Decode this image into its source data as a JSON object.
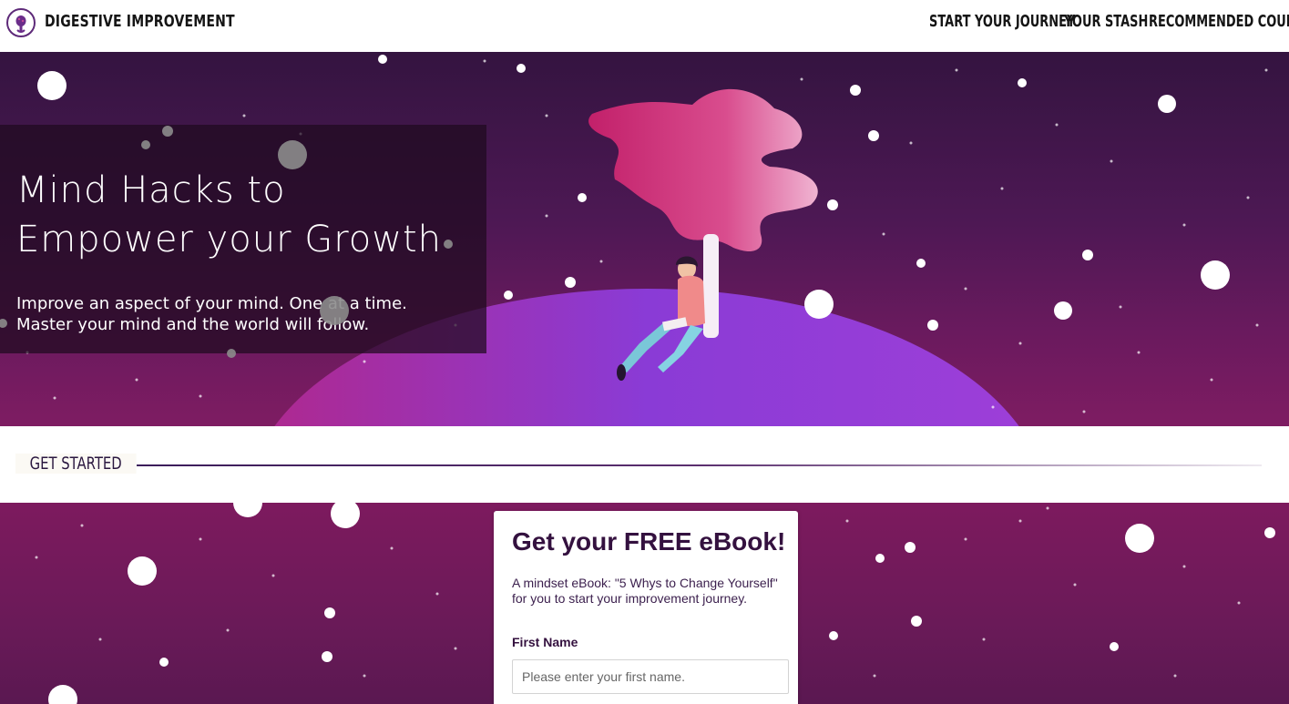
{
  "header": {
    "brand": "DIGESTIVE IMPROVEMENT",
    "nav": [
      {
        "label": "START YOUR JOURNEY"
      },
      {
        "label": "YOUR STASH"
      },
      {
        "label": "RECOMMENDED COURSES"
      }
    ]
  },
  "hero": {
    "title": "Mind Hacks to Empower your Growth",
    "subtitle_line1": "Improve an aspect of your mind. One at a time.",
    "subtitle_line2": "Master your mind and the world will follow."
  },
  "get_started": {
    "label": "GET STARTED"
  },
  "form": {
    "title": "Get your FREE eBook!",
    "description": "A mindset eBook: \"5 Whys to Change Yourself\" for you to start your improvement journey.",
    "first_name_label": "First Name",
    "first_name_placeholder": "Please enter your first name.",
    "first_name_value": ""
  },
  "colors": {
    "header_bg": "#ffffff",
    "hero_top": "#341440",
    "hero_bottom": "#7e1c62",
    "planet": "#8a3bd6",
    "tree": "#c2206a",
    "card_title": "#34113f"
  }
}
